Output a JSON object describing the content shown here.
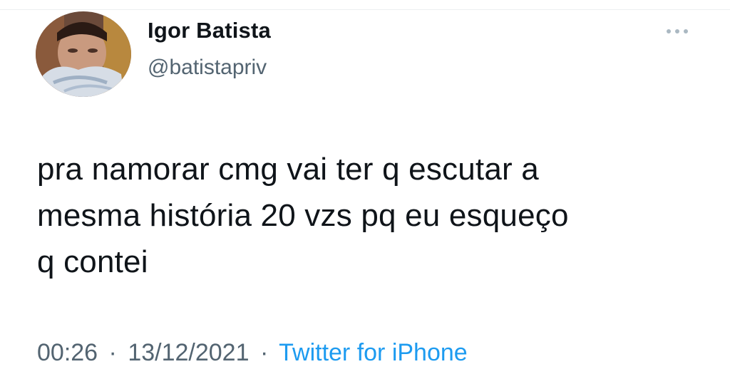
{
  "tweet": {
    "display_name": "Igor Batista",
    "handle": "@batistapriv",
    "text": "pra namorar cmg  vai ter q escutar a\nmesma história 20 vzs  pq eu esqueço\nq contei",
    "time": "00:26",
    "date": "13/12/2021",
    "separator": "·",
    "source": "Twitter for iPhone"
  },
  "icons": {
    "avatar": "profile-photo",
    "more": "more-horizontal-icon"
  },
  "colors": {
    "name_text": "#0f1419",
    "secondary_text": "#536471",
    "link": "#1d9bf0",
    "background": "#ffffff"
  }
}
